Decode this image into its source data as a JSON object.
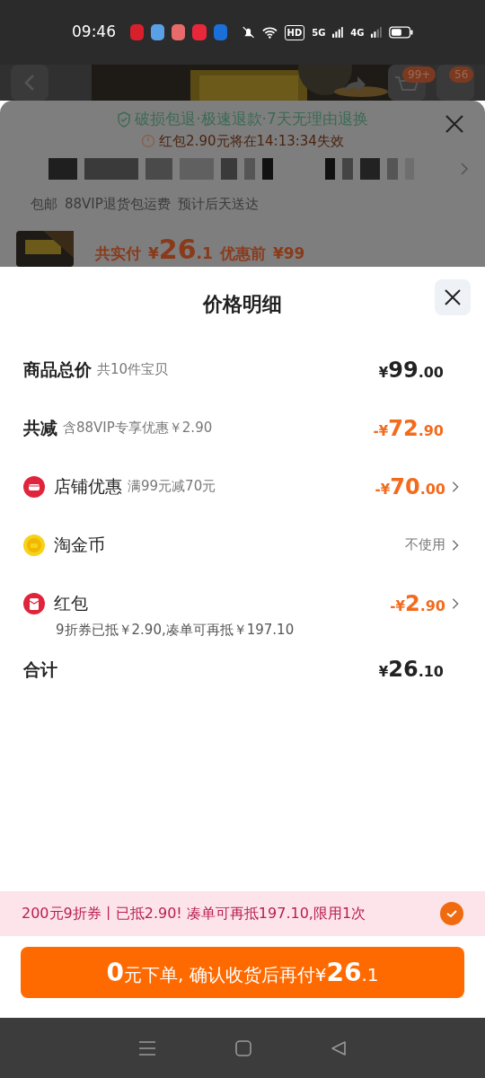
{
  "status_bar": {
    "time": "09:46",
    "apps": [
      {
        "color": "#d8202c"
      },
      {
        "color": "#5aa0e6"
      },
      {
        "color": "#e86a6a"
      },
      {
        "color": "#e8283a"
      },
      {
        "color": "#1a6fd8"
      }
    ],
    "hd": "HD",
    "net1": "5G",
    "net2": "4G"
  },
  "background": {
    "cart_badge": "99+",
    "msg_badge": "56",
    "guarantee": "破损包退·极速退款·7天无理由退换",
    "expiry": "红包2.90元将在14:13:34失效",
    "services": [
      "包邮",
      "88VIP退货包运费",
      "预计后天送达"
    ],
    "paid_label": "共实付",
    "paid_currency": "¥",
    "paid_int": "26",
    "paid_dec": ".1",
    "before_label": "优惠前",
    "before_value": "¥99"
  },
  "sheet": {
    "title": "价格明细",
    "rows": [
      {
        "kind": "plain",
        "label": "商品总价",
        "note": "共10件宝贝",
        "prefix": "¥",
        "int": "99",
        "dec": ".00",
        "highlight": false,
        "chevron": false
      },
      {
        "kind": "plain",
        "label": "共减",
        "note": "含88VIP专享优惠￥2.90",
        "prefix": "-¥",
        "int": "72",
        "dec": ".90",
        "highlight": true,
        "chevron": false
      },
      {
        "kind": "shop",
        "label": "店铺优惠",
        "note": "满99元减70元",
        "prefix": "-¥",
        "int": "70",
        "dec": ".00",
        "highlight": true,
        "chevron": true
      },
      {
        "kind": "coin",
        "label": "淘金币",
        "value": "不使用",
        "chevron": true
      },
      {
        "kind": "packet",
        "label": "红包",
        "prefix": "-¥",
        "int": "2",
        "dec": ".90",
        "highlight": true,
        "chevron": true,
        "sub": "9折券已抵￥2.90,凑单可再抵￥197.10"
      },
      {
        "kind": "total",
        "label": "合计",
        "prefix": "¥",
        "int": "26",
        "dec": ".10",
        "highlight": false,
        "chevron": false
      }
    ],
    "coupon": {
      "text": "200元9折券丨已抵2.90! 凑单可再抵197.10,限用1次",
      "checked": true
    },
    "button": {
      "lead": "0",
      "text": "元下单, 确认收货后再付",
      "currency": "¥",
      "int": "26",
      "dec": ".1"
    }
  }
}
